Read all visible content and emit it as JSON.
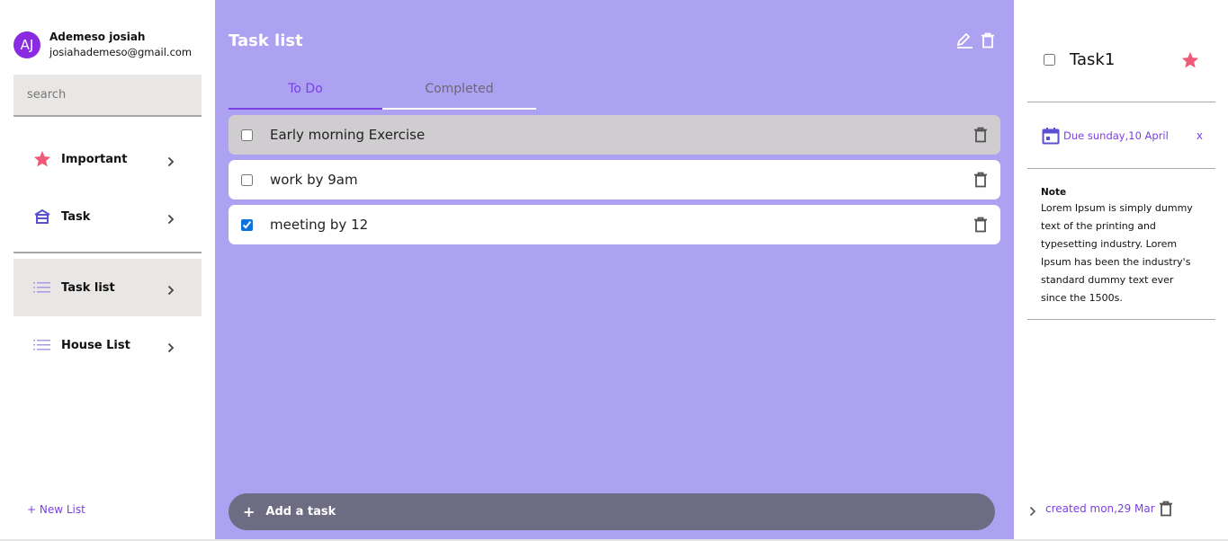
{
  "user": {
    "initials": "AJ",
    "name": "Ademeso josiah",
    "email": "josiahademeso@gmail.com"
  },
  "search": {
    "placeholder": "search"
  },
  "nav": {
    "important": "Important",
    "task": "Task",
    "task_list": "Task list",
    "house_list": "House List"
  },
  "new_list": "+ New List",
  "main": {
    "title": "Task list",
    "tabs": {
      "todo": "To Do",
      "completed": "Completed"
    },
    "tasks": [
      {
        "text": "Early morning Exercise",
        "checked": false
      },
      {
        "text": "work by 9am",
        "checked": false
      },
      {
        "text": "meeting by 12",
        "checked": true
      }
    ],
    "add_plus": "+",
    "add_label": "Add a task"
  },
  "detail": {
    "title": "Task1",
    "due": "Due sunday,10 April",
    "due_close": "x",
    "note_label": "Note",
    "note_text": "Lorem Ipsum is simply dummy text of the printing and typesetting industry. Lorem Ipsum has been the industry's standard dummy text ever since the 1500s.",
    "created": "created mon,29 Mar"
  },
  "colors": {
    "accent": "#7b3fe4",
    "main_bg": "#ada1f2",
    "star": "#ee5a78",
    "add_bar": "#6e6c83",
    "avatar": "#8a2be2"
  }
}
